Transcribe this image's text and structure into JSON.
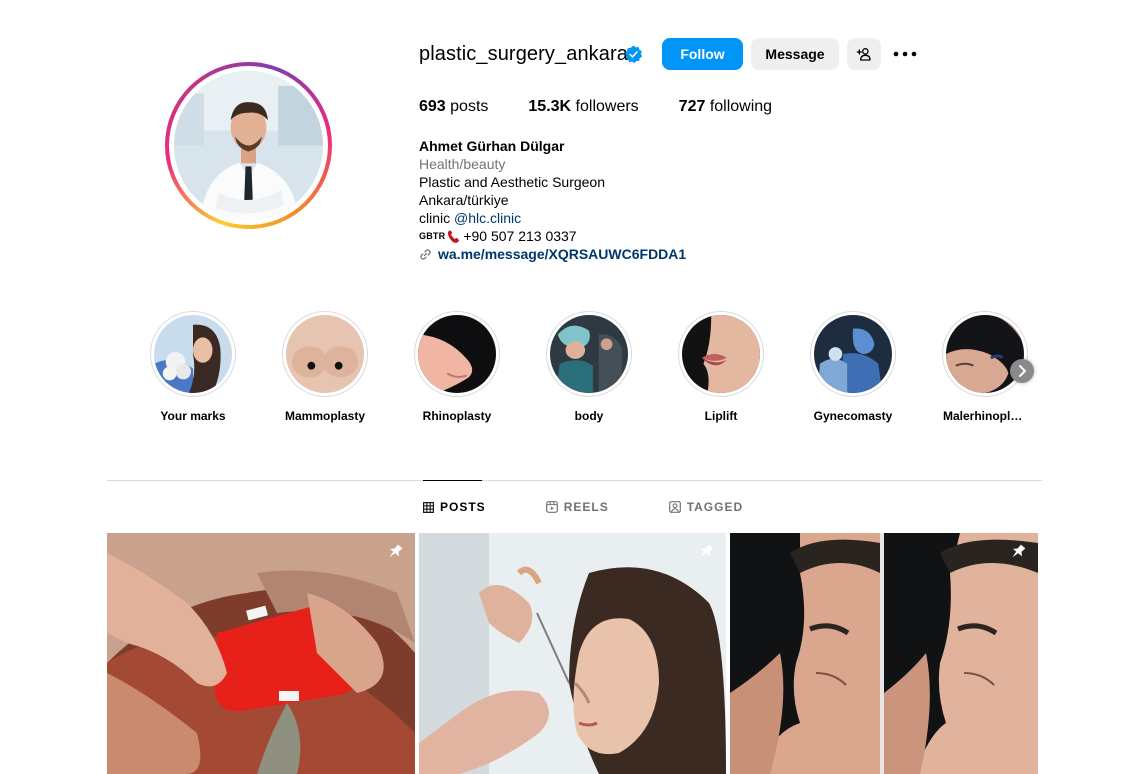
{
  "profile": {
    "username": "plastic_surgery_ankara",
    "follow_label": "Follow",
    "message_label": "Message",
    "stats": {
      "posts_count": "693",
      "posts_label": " posts",
      "followers_count": "15.3K",
      "followers_label": " followers",
      "following_count": "727",
      "following_label": " following"
    },
    "bio": {
      "full_name": "Ahmet Gürhan Dülgar",
      "category": "Health/beauty",
      "line1": "Plastic and Aesthetic Surgeon",
      "line2": "Ankara/türkiye",
      "line3_prefix": "clinic ",
      "line3_mention": "@hlc.clinic",
      "line4_prefix": "GBTR",
      "line4_phone": "+90 507 213 0337",
      "link": "wa.me/message/XQRSAUWC6FDDA1"
    }
  },
  "highlights": [
    {
      "label": "Your marks"
    },
    {
      "label": "Mammoplasty"
    },
    {
      "label": "Rhinoplasty"
    },
    {
      "label": "body"
    },
    {
      "label": "Liplift"
    },
    {
      "label": "Gynecomasty"
    },
    {
      "label": "Malerhinoplasty"
    }
  ],
  "tabs": {
    "posts": "POSTS",
    "reels": "REELS",
    "tagged": "TAGGED"
  },
  "colors": {
    "accent": "#0095f6",
    "secondary_button": "#efefef",
    "link": "#00376b",
    "muted": "#737373"
  },
  "icons": {
    "verified": "verified-badge-icon",
    "add_user": "add-user-icon",
    "more": "more-icon",
    "link": "link-icon",
    "phone": "phone-icon",
    "pin": "pin-icon"
  }
}
